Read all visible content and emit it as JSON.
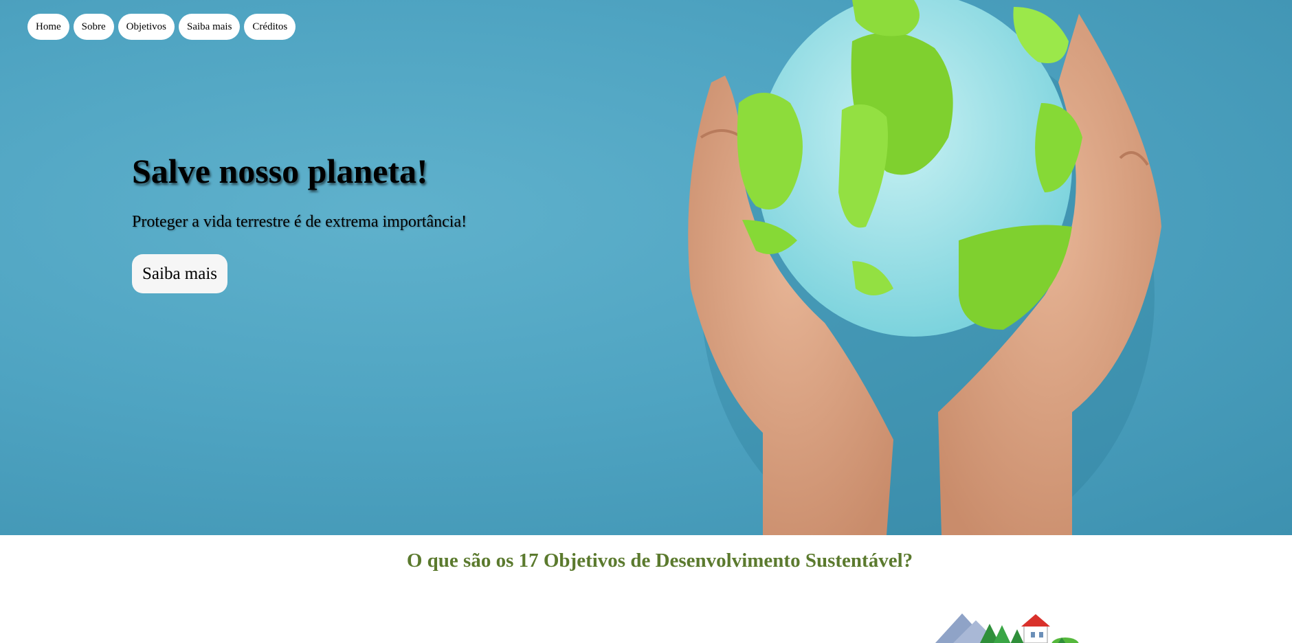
{
  "nav": {
    "items": [
      {
        "label": "Home"
      },
      {
        "label": "Sobre"
      },
      {
        "label": "Objetivos"
      },
      {
        "label": "Saiba mais"
      },
      {
        "label": "Créditos"
      }
    ]
  },
  "hero": {
    "title": "Salve nosso planeta!",
    "subtitle": "Proteger a vida terrestre é de extrema importância!",
    "button_label": "Saiba mais",
    "image": "hands-holding-paper-globe"
  },
  "section": {
    "title": "O que são os 17 Objetivos de Desenvolvimento Sustentável?",
    "image": "landscape-illustration"
  },
  "colors": {
    "hero_background": "#4fa4c2",
    "section_title": "#5b7a2e",
    "nav_pill": "#ffffff"
  }
}
